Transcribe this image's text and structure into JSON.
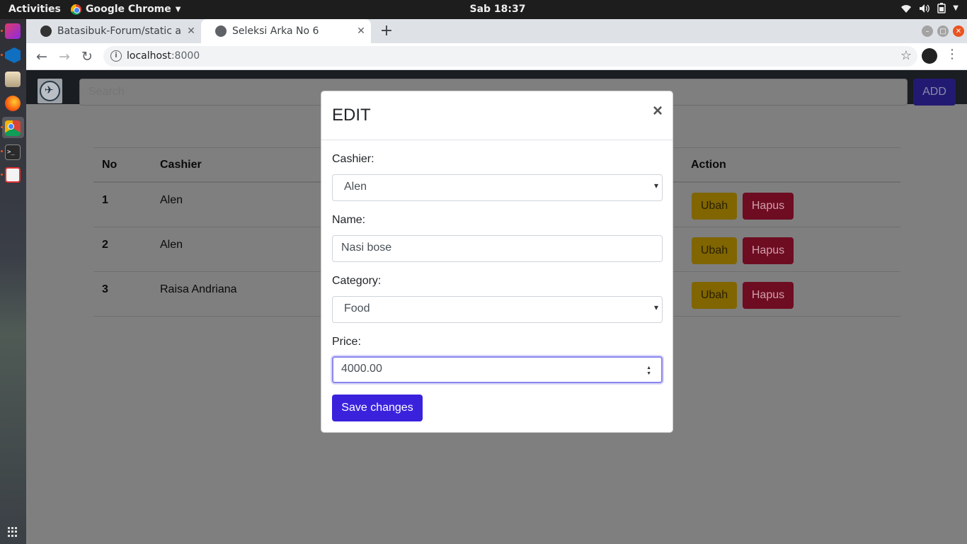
{
  "system": {
    "activities": "Activities",
    "app_menu": "Google Chrome",
    "clock": "Sab 18:37"
  },
  "browser": {
    "tabs": [
      {
        "title": "Batasibuk-Forum/static a"
      },
      {
        "title": "Seleksi Arka No 6"
      }
    ],
    "url_host": "localhost",
    "url_port": ":8000"
  },
  "navbar": {
    "search_placeholder": "Search",
    "add_label": "ADD"
  },
  "table": {
    "headers": {
      "no": "No",
      "cashier": "Cashier",
      "action": "Action"
    },
    "rows": [
      {
        "no": "1",
        "cashier": "Alen"
      },
      {
        "no": "2",
        "cashier": "Alen"
      },
      {
        "no": "3",
        "cashier": "Raisa Andriana"
      }
    ],
    "edit_label": "Ubah",
    "delete_label": "Hapus"
  },
  "modal": {
    "title": "EDIT",
    "close": "×",
    "cashier_label": "Cashier:",
    "cashier_value": "Alen",
    "name_label": "Name:",
    "name_value": "Nasi bose",
    "category_label": "Category:",
    "category_value": "Food",
    "price_label": "Price:",
    "price_value": "4000.00",
    "save_label": "Save changes"
  },
  "colors": {
    "primary": "#3a22dd",
    "warning": "#ffc107",
    "danger": "#dc143c",
    "navbar": "#343a40"
  }
}
